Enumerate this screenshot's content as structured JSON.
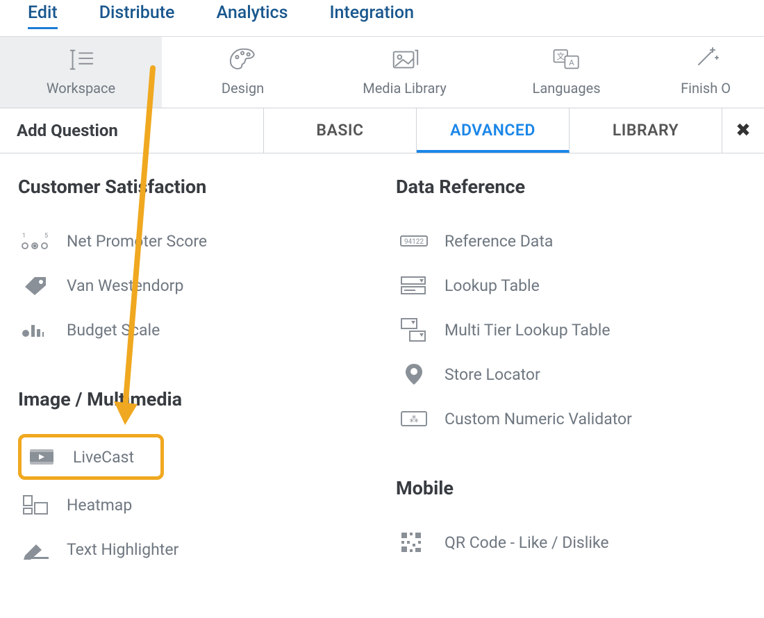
{
  "colors": {
    "highlight": "#f0a820",
    "primary": "#1a86e8",
    "nav": "#19578e"
  },
  "top_nav": {
    "items": [
      {
        "label": "Edit",
        "active": true
      },
      {
        "label": "Distribute",
        "active": false
      },
      {
        "label": "Analytics",
        "active": false
      },
      {
        "label": "Integration",
        "active": false
      }
    ]
  },
  "toolbar": {
    "items": [
      {
        "label": "Workspace",
        "active": true
      },
      {
        "label": "Design",
        "active": false
      },
      {
        "label": "Media Library",
        "active": false
      },
      {
        "label": "Languages",
        "active": false
      },
      {
        "label": "Finish O",
        "active": false
      }
    ]
  },
  "subtabs": {
    "title": "Add Question",
    "items": [
      {
        "label": "BASIC",
        "active": false
      },
      {
        "label": "ADVANCED",
        "active": true
      },
      {
        "label": "LIBRARY",
        "active": false
      }
    ]
  },
  "sections": {
    "customer_satisfaction": {
      "heading": "Customer Satisfaction",
      "items": [
        {
          "label": "Net Promoter Score"
        },
        {
          "label": "Van Westendorp"
        },
        {
          "label": "Budget Scale"
        }
      ]
    },
    "image_multimedia": {
      "heading": "Image / Multimedia",
      "items": [
        {
          "label": "LiveCast",
          "highlighted": true
        },
        {
          "label": "Heatmap"
        },
        {
          "label": "Text Highlighter"
        }
      ]
    },
    "data_reference": {
      "heading": "Data Reference",
      "items": [
        {
          "label": "Reference Data"
        },
        {
          "label": "Lookup Table"
        },
        {
          "label": "Multi Tier Lookup Table"
        },
        {
          "label": "Store Locator"
        },
        {
          "label": "Custom Numeric Validator"
        }
      ]
    },
    "mobile": {
      "heading": "Mobile",
      "items": [
        {
          "label": "QR Code - Like / Dislike"
        }
      ]
    }
  }
}
